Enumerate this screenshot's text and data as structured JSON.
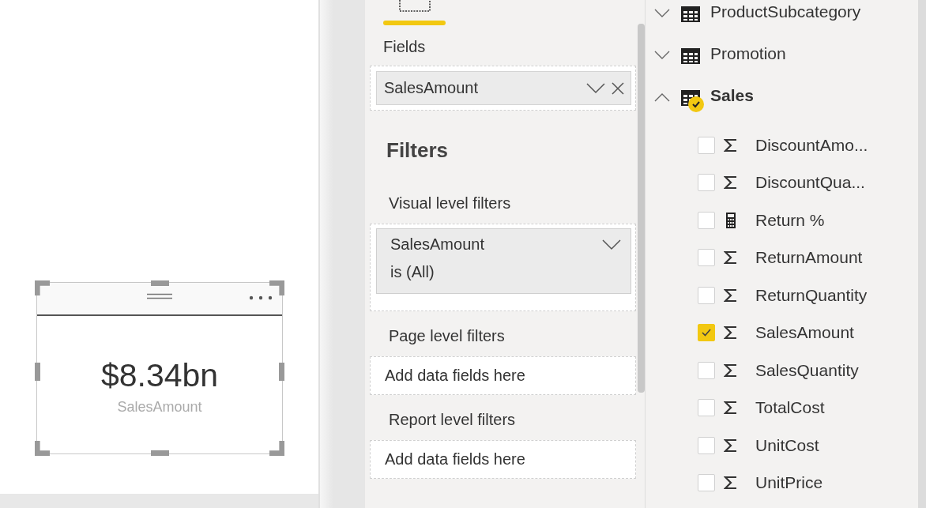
{
  "card": {
    "value": "$8.34bn",
    "label": "SalesAmount"
  },
  "pane_tab": {
    "selected": true
  },
  "fields_well": {
    "label": "Fields",
    "chip": "SalesAmount"
  },
  "filters": {
    "title": "Filters",
    "sections": [
      {
        "label": "Visual level filters",
        "kind": "filter",
        "field": "SalesAmount",
        "condition": "is (All)"
      },
      {
        "label": "Page level filters",
        "kind": "empty",
        "placeholder": "Add data fields here"
      },
      {
        "label": "Report level filters",
        "kind": "empty",
        "placeholder": "Add data fields here"
      }
    ]
  },
  "tables": [
    {
      "name": "ProductSubcategory",
      "expanded": false,
      "has_selection": false
    },
    {
      "name": "Promotion",
      "expanded": false,
      "has_selection": false
    },
    {
      "name": "Sales",
      "expanded": true,
      "has_selection": true,
      "fields": [
        {
          "name": "DiscountAmo...",
          "kind": "sum",
          "checked": false
        },
        {
          "name": "DiscountQua...",
          "kind": "sum",
          "checked": false
        },
        {
          "name": "Return %",
          "kind": "calc",
          "checked": false
        },
        {
          "name": "ReturnAmount",
          "kind": "sum",
          "checked": false
        },
        {
          "name": "ReturnQuantity",
          "kind": "sum",
          "checked": false
        },
        {
          "name": "SalesAmount",
          "kind": "sum",
          "checked": true
        },
        {
          "name": "SalesQuantity",
          "kind": "sum",
          "checked": false
        },
        {
          "name": "TotalCost",
          "kind": "sum",
          "checked": false
        },
        {
          "name": "UnitCost",
          "kind": "sum",
          "checked": false
        },
        {
          "name": "UnitPrice",
          "kind": "sum",
          "checked": false
        }
      ]
    }
  ]
}
